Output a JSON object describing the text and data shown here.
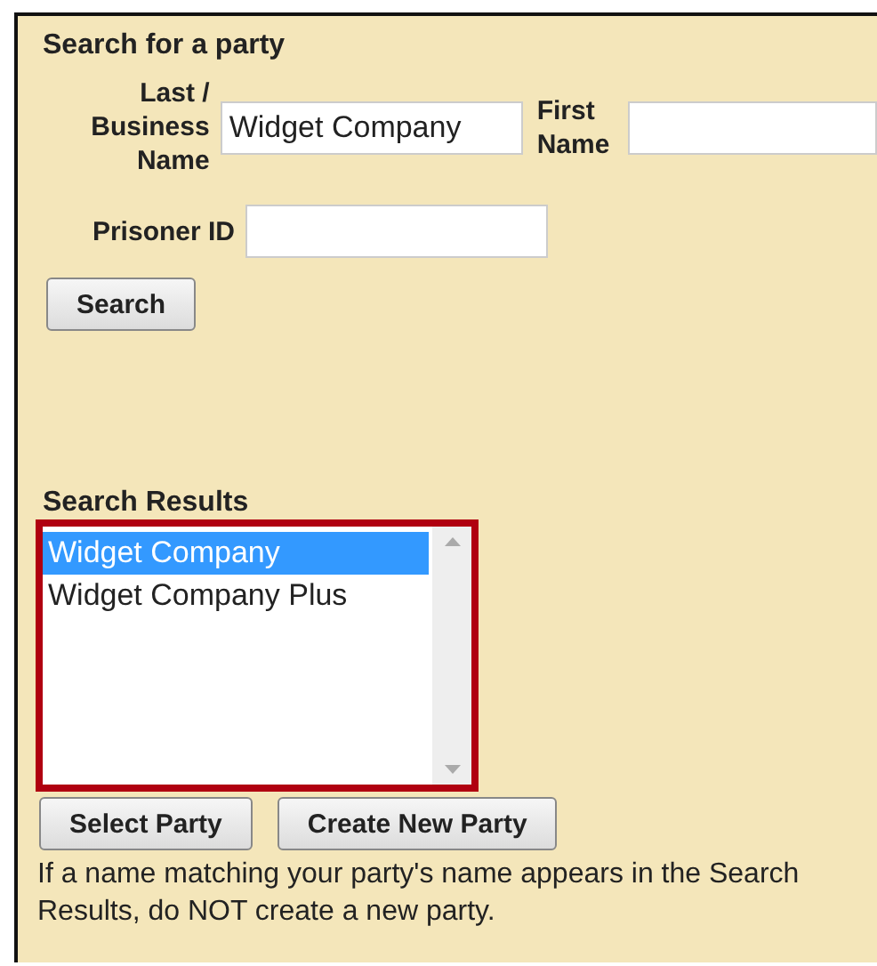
{
  "title": "Search for a party",
  "fields": [
    {
      "label": "Last / Business Name",
      "value": "Widget Company"
    },
    {
      "label": "First Name"
    },
    {
      "label": "Prisoner ID"
    }
  ],
  "search_button": "Search",
  "results": {
    "title": "Search Results",
    "highlighted": true,
    "items": [
      {
        "label": "Widget Company",
        "selected": true
      },
      {
        "label": "Widget Company Plus",
        "selected": false
      }
    ]
  },
  "buttons": [
    "Select Party",
    "Create New Party"
  ],
  "note": "If a name matching your party's name appears in the Search Results, do NOT create a new party."
}
